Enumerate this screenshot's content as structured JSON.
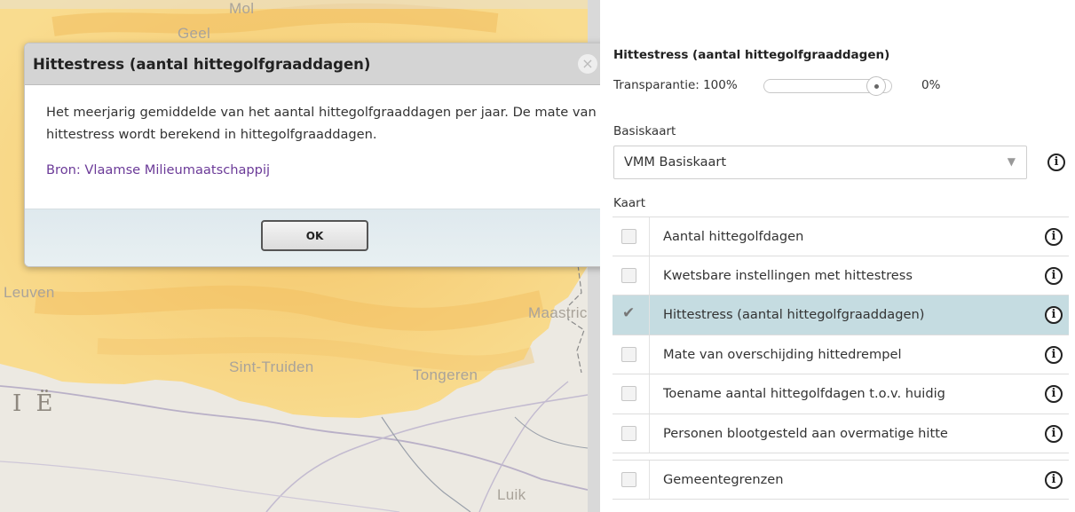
{
  "map": {
    "labels": {
      "mol": "Mol",
      "geel": "Geel",
      "leuven": "Leuven",
      "maastricht": "Maastric",
      "sint_truiden": "Sint-Truiden",
      "tongeren": "Tongeren",
      "region": "I Ë",
      "luik": "Luik"
    }
  },
  "dialog": {
    "title": "Hittestress (aantal hittegolfgraaddagen)",
    "close_icon": "×",
    "text": "Het meerjarig gemiddelde van het aantal hittegolfgraaddagen per jaar. De mate van hittestress wordt berekend in hittegolfgraaddagen.",
    "source": "Bron: Vlaamse Milieumaatschappij",
    "ok_label": "OK"
  },
  "panel": {
    "layer_title": "Hittestress (aantal hittegolfgraaddagen)",
    "transparency_label": "Transparantie: 100%",
    "transparency_max": "0%",
    "transparency_value_fraction": 0.9,
    "basemap_label": "Basiskaart",
    "basemap_value": "VMM Basiskaart",
    "basemap_arrow": "▼",
    "info_glyph": "i",
    "kaart_label": "Kaart",
    "layers": [
      {
        "label": "Aantal hittegolfdagen",
        "checked": false
      },
      {
        "label": "Kwetsbare instellingen met hittestress",
        "checked": false
      },
      {
        "label": "Hittestress (aantal hittegolfgraaddagen)",
        "checked": true
      },
      {
        "label": "Mate van overschijding hittedrempel",
        "checked": false
      },
      {
        "label": "Toename aantal hittegolfdagen t.o.v. huidig",
        "checked": false
      },
      {
        "label": "Personen blootgesteld aan overmatige hitte",
        "checked": false
      },
      {
        "label": "Gemeentegrenzen",
        "checked": false
      }
    ]
  },
  "colors": {
    "heat_fill": "#f7d27a",
    "map_background": "#ece9e2",
    "active_row": "#c5dce1",
    "source_link": "#6b3a98"
  }
}
